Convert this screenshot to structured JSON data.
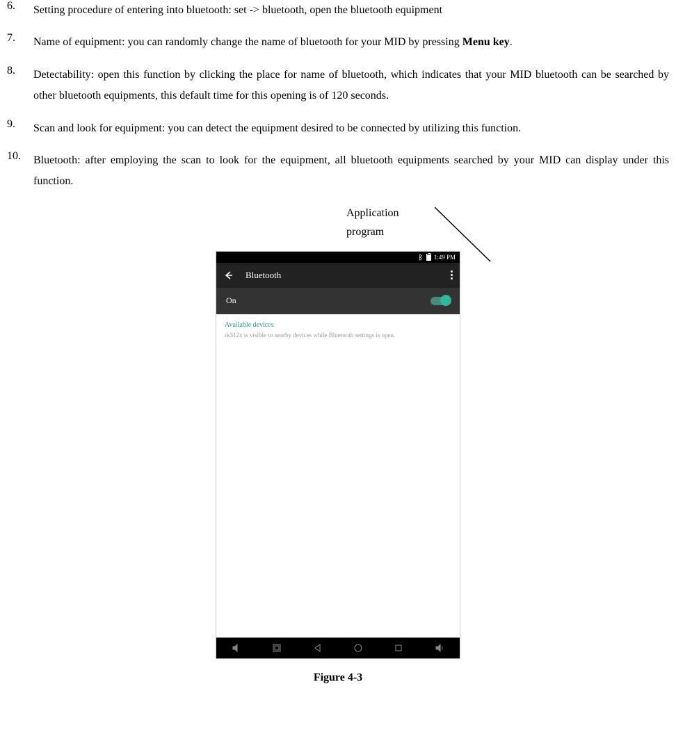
{
  "list": {
    "item6": {
      "num": "6.",
      "text": "Setting procedure of entering into bluetooth: set -> bluetooth, open the bluetooth equipment"
    },
    "item7": {
      "num": "7.",
      "text_a": "Name of equipment: you can randomly change the name of bluetooth for your MID by pressing ",
      "bold": "Menu key",
      "text_b": "."
    },
    "item8": {
      "num": "8.",
      "text": "Detectability: open this function by clicking the place for name of bluetooth, which indicates that your MID bluetooth can be searched by other bluetooth equipments, this default time for this opening is of 120 seconds."
    },
    "item9": {
      "num": "9.",
      "text": "Scan and look for equipment: you can detect the equipment desired to be connected by utilizing this function."
    },
    "item10": {
      "num": "10.",
      "text": "Bluetooth: after employing the scan to look for the equipment, all bluetooth equipments searched by your MID can display under this function."
    }
  },
  "annotation": {
    "line1": "Application",
    "line2": "program"
  },
  "phone": {
    "status_time": "1:49 PM",
    "header_title": "Bluetooth",
    "on_label": "On",
    "section_label": "Available devices",
    "visibility_text": "rk312x is visible to nearby devices while Bluetooth settings is open."
  },
  "caption": "Figure 4-3"
}
